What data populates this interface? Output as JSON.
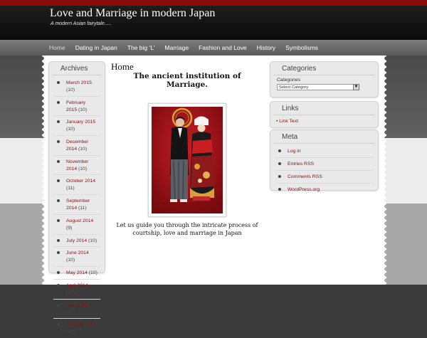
{
  "site": {
    "title": "Love and Marriage in modern Japan",
    "description": "A modern Asian fairytale....."
  },
  "nav": {
    "items": [
      {
        "label": "Home",
        "active": true
      },
      {
        "label": "Dating in Japan"
      },
      {
        "label": "The big ‘L’"
      },
      {
        "label": "Marriage"
      },
      {
        "label": "Fashion and Love"
      },
      {
        "label": "History"
      },
      {
        "label": "Symbolisms"
      }
    ]
  },
  "archives": {
    "title": "Archives",
    "items": [
      {
        "label": "March 2015",
        "count": "(10)"
      },
      {
        "label": "February 2015",
        "count": "(10)"
      },
      {
        "label": "January 2015",
        "count": "(10)"
      },
      {
        "label": "December 2014",
        "count": "(10)"
      },
      {
        "label": "November 2014",
        "count": "(10)"
      },
      {
        "label": "October 2014",
        "count": "(11)"
      },
      {
        "label": "September 2014",
        "count": "(11)"
      },
      {
        "label": "August 2014",
        "count": "(9)"
      },
      {
        "label": "July 2014",
        "count": "(10)"
      },
      {
        "label": "June 2014",
        "count": "(10)"
      },
      {
        "label": "May 2014",
        "count": "(10)"
      },
      {
        "label": "April 2014",
        "count": "(10)"
      },
      {
        "label": "March 2014",
        "count": "(10)"
      },
      {
        "label": "January 2014",
        "count": "(10)"
      }
    ]
  },
  "main": {
    "page_title": "Home",
    "post_heading": "The ancient institution of Marriage.",
    "body": "Let us guide you through the intricate process of courtship, love and marriage in Japan"
  },
  "categories": {
    "title": "Categories",
    "label": "Categories",
    "select_value": "Select Category"
  },
  "links": {
    "title": "Links",
    "item": "Link Text"
  },
  "meta": {
    "title": "Meta",
    "items": [
      "Log in",
      "Entries RSS",
      "Comments RSS",
      "WordPress.org"
    ]
  },
  "colors": {
    "accent": "#8b1010",
    "header_bg": "#111111",
    "top_strip": "#8a0c0c"
  }
}
